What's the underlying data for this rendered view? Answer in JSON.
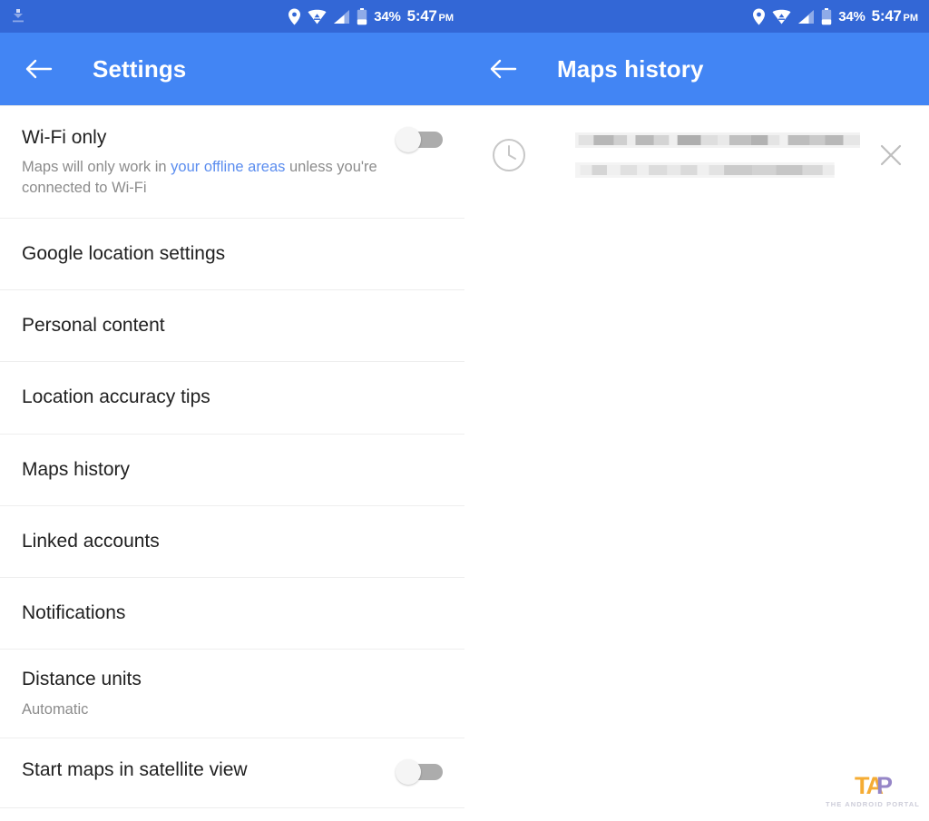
{
  "status_bar": {
    "download_icon": "download-icon",
    "location_icon": "location-pin-icon",
    "wifi_icon": "wifi-icon",
    "signal_icon": "cellular-signal-icon",
    "battery_icon": "battery-icon",
    "battery_text": "34%",
    "time": "5:47",
    "am_pm": "PM",
    "background_color": "#3367D6",
    "text_color": "#FFFFFF"
  },
  "theme": {
    "app_bar_color": "#4285F4",
    "link_color": "#5B8DEF",
    "primary_text_color": "#212121",
    "secondary_text_color": "#8C8C8C",
    "divider_color": "#EEEEEE"
  },
  "settings_screen": {
    "back_icon": "back-arrow-icon",
    "title": "Settings",
    "rows": [
      {
        "title": "Wi-Fi only",
        "sub_prefix": "Maps will only work in ",
        "sub_link": "your offline areas",
        "sub_suffix": " unless you're connected to Wi-Fi",
        "toggle": "off"
      },
      {
        "title": "Google location settings"
      },
      {
        "title": "Personal content"
      },
      {
        "title": "Location accuracy tips"
      },
      {
        "title": "Maps history"
      },
      {
        "title": "Linked accounts"
      },
      {
        "title": "Notifications"
      },
      {
        "title": "Distance units",
        "sub": "Automatic"
      },
      {
        "title": "Start maps in satellite view",
        "toggle": "off"
      }
    ]
  },
  "history_screen": {
    "back_icon": "back-arrow-icon",
    "title": "Maps history",
    "items": [
      {
        "icon": "clock-history-icon",
        "line1": "",
        "line2": "",
        "redacted": true,
        "remove_icon": "close-x-icon"
      }
    ]
  },
  "watermark": {
    "logo_t": "T",
    "logo_a": "A",
    "logo_p": "P",
    "tagline": "THE ANDROID PORTAL",
    "logo_color_1": "#F5A623",
    "logo_color_2": "#8E7CC3"
  }
}
